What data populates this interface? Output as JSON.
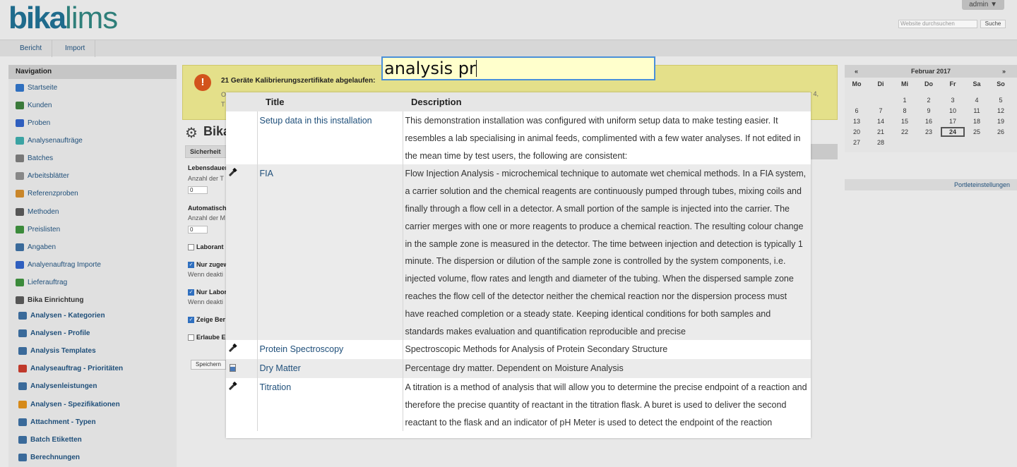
{
  "header": {
    "logo_bold": "bika",
    "logo_light": "lims",
    "user_menu": "admin ▼",
    "search_placeholder": "Website durchsuchen",
    "search_button": "Suche"
  },
  "topnav": [
    "Bericht",
    "Import"
  ],
  "sidebar": {
    "title": "Navigation",
    "items": [
      {
        "label": "Startseite",
        "icon": "home-icon",
        "color": "#2f6fbf"
      },
      {
        "label": "Kunden",
        "icon": "clients-icon",
        "color": "#3b7a3b"
      },
      {
        "label": "Proben",
        "icon": "sample-icon",
        "color": "#2f5fbf"
      },
      {
        "label": "Analysenaufträge",
        "icon": "analysis-request-icon",
        "color": "#3ba3a3"
      },
      {
        "label": "Batches",
        "icon": "batches-icon",
        "color": "#777777"
      },
      {
        "label": "Arbeitsblätter",
        "icon": "worksheets-icon",
        "color": "#888888"
      },
      {
        "label": "Referenzproben",
        "icon": "reference-samples-icon",
        "color": "#c9862a"
      },
      {
        "label": "Methoden",
        "icon": "methods-icon",
        "color": "#555555"
      },
      {
        "label": "Preislisten",
        "icon": "pricelists-icon",
        "color": "#3b8a3b"
      },
      {
        "label": "Angaben",
        "icon": "supply-orders-icon",
        "color": "#3a6a9a"
      },
      {
        "label": "Analyenauftrag Importe",
        "icon": "import-icon",
        "color": "#2f5fbf"
      },
      {
        "label": "Lieferauftrag",
        "icon": "delivery-icon",
        "color": "#3b8a3b"
      }
    ],
    "setup_heading": "Bika Einrichtung",
    "setup_items": [
      {
        "label": "Analysen - Kategorien",
        "icon": "categories-icon",
        "color": "#3a6a9a"
      },
      {
        "label": "Analysen - Profile",
        "icon": "profiles-icon",
        "color": "#3a6a9a"
      },
      {
        "label": "Analysis Templates",
        "icon": "templates-icon",
        "color": "#3a6a9a"
      },
      {
        "label": "Analyseauftrag - Prioritäten",
        "icon": "priorities-icon",
        "color": "#c0392b"
      },
      {
        "label": "Analysenleistungen",
        "icon": "services-icon",
        "color": "#3a6a9a"
      },
      {
        "label": "Analysen - Spezifikationen",
        "icon": "specifications-icon",
        "color": "#d68a1a"
      },
      {
        "label": "Attachment - Typen",
        "icon": "attachment-icon",
        "color": "#3a6a9a"
      },
      {
        "label": "Batch Etiketten",
        "icon": "batch-labels-icon",
        "color": "#3a6a9a"
      },
      {
        "label": "Berechnungen",
        "icon": "calculations-icon",
        "color": "#3a6a9a"
      }
    ]
  },
  "alert": {
    "title": "21 Geräte Kalibrierungszertifikate abgelaufen:",
    "line1_start": "O",
    "line1_end": "r 4,",
    "line2_start": "T"
  },
  "page": {
    "title_partial": "Bika",
    "tab_label": "Sicherheit",
    "fields": [
      {
        "label": "Lebensdauer",
        "help": "Anzahl der T",
        "value": "0"
      },
      {
        "label": "Automatisch",
        "help": "Anzahl der M",
        "value": "0"
      }
    ],
    "checks": [
      {
        "label": "Laborant",
        "checked": false
      },
      {
        "label": "Nur zugew",
        "help": "Wenn deakti",
        "checked": true
      },
      {
        "label": "Nur Labor",
        "help": "Wenn deakti",
        "checked": true
      },
      {
        "label": "Zeige Ber",
        "checked": true
      },
      {
        "label": "Erlaube E",
        "checked": false
      }
    ],
    "save_label": "Speichern"
  },
  "calendar": {
    "prev": "«",
    "next": "»",
    "month": "Februar 2017",
    "weekdays": [
      "Mo",
      "Di",
      "Mi",
      "Do",
      "Fr",
      "Sa",
      "So"
    ],
    "weeks": [
      [
        "",
        "",
        "1",
        "2",
        "3",
        "4",
        "5"
      ],
      [
        "6",
        "7",
        "8",
        "9",
        "10",
        "11",
        "12"
      ],
      [
        "13",
        "14",
        "15",
        "16",
        "17",
        "18",
        "19"
      ],
      [
        "20",
        "21",
        "22",
        "23",
        "24",
        "25",
        "26"
      ],
      [
        "27",
        "28",
        "",
        "",
        "",
        "",
        ""
      ]
    ],
    "today": "24",
    "settings_link": "Portleteinstellungen"
  },
  "autocomplete": {
    "query": "analysis pr",
    "columns": [
      "Title",
      "Description"
    ],
    "rows": [
      {
        "icon": "",
        "title": "Setup data in this installation",
        "description": "This demonstration installation was configured with uniform setup data to make testing easier. It resembles a lab specialising in animal feeds, complimented with a few water analyses. If not edited in the mean time by test users, the following are consistent:"
      },
      {
        "icon": "pipette-icon",
        "title": "FIA",
        "description": "Flow Injection Analysis - microchemical technique to automate wet chemical methods. In a FIA system, a carrier solution and the chemical reagents are continuously pumped through tubes, mixing coils and finally through a flow cell in a detector. A small portion of the sample is injected into the carrier. The carrier merges with one or more reagents to produce a chemical reaction. The resulting colour change in the sample zone is measured in the detector. The time between injection and detection is typically 1 minute. The dispersion or dilution of the sample zone is controlled by the system components, i.e. injected volume, flow rates and length and diameter of the tubing. When the dispersed sample zone reaches the flow cell of the detector neither the chemical reaction nor the dispersion process must have reached completion or a steady state. Keeping identical conditions for both samples and standards makes evaluation and quantification reproducible and precise"
      },
      {
        "icon": "pipette-icon",
        "title": "Protein Spectroscopy",
        "description": "Spectroscopic Methods for Analysis of Protein Secondary Structure"
      },
      {
        "icon": "beaker-icon",
        "title": "Dry Matter",
        "description": "Percentage dry matter. Dependent on Moisture Analysis"
      },
      {
        "icon": "pipette-icon",
        "title": "Titration",
        "description": "A titration is a method of analysis that will allow you to determine the precise endpoint of a reaction and therefore the precise quantity of reactant in the titration flask. A buret is used to deliver the second reactant to the flask and an indicator of pH Meter is used to detect the endpoint of the reaction"
      }
    ]
  }
}
